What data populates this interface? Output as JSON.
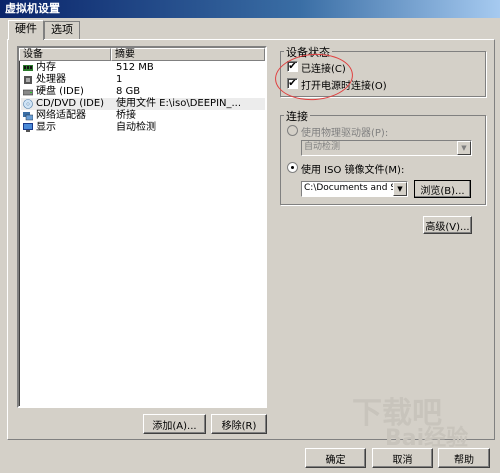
{
  "window": {
    "title": "虚拟机设置"
  },
  "tabs": [
    {
      "label": "硬件",
      "active": true
    },
    {
      "label": "选项",
      "active": false
    }
  ],
  "hardware": {
    "columns": {
      "device": "设备",
      "summary": "摘要"
    },
    "rows": [
      {
        "device": "内存",
        "summary": "512 MB",
        "icon": "memory-icon"
      },
      {
        "device": "处理器",
        "summary": "1",
        "icon": "processor-icon"
      },
      {
        "device": "硬盘 (IDE)",
        "summary": "8 GB",
        "icon": "harddisk-icon"
      },
      {
        "device": "CD/DVD (IDE)",
        "summary": "使用文件 E:\\iso\\DEEPIN_...",
        "icon": "cdrom-icon",
        "selected": true
      },
      {
        "device": "网络适配器",
        "summary": "桥接",
        "icon": "network-icon"
      },
      {
        "device": "显示",
        "summary": "自动检测",
        "icon": "display-icon"
      }
    ],
    "add_button": "添加(A)...",
    "remove_button": "移除(R)"
  },
  "device_status": {
    "title": "设备状态",
    "connected": {
      "label": "已连接(C)",
      "checked": true
    },
    "connect_at_power_on": {
      "label": "打开电源时连接(O)",
      "checked": true
    }
  },
  "connection": {
    "title": "连接",
    "physical_drive": {
      "label": "使用物理驱动器(P):",
      "selected": false,
      "disabled": true
    },
    "physical_drive_combo": "自动检测",
    "iso_image": {
      "label": "使用 ISO 镜像文件(M):",
      "selected": true
    },
    "iso_path": "C:\\Documents and Se",
    "browse_button": "浏览(B)...",
    "advanced_button": "高级(V)..."
  },
  "footer": {
    "ok_button": "确定",
    "cancel_button": "取消",
    "help_button": "帮助"
  },
  "watermark": {
    "text1": "下载吧",
    "text2": "Bai经验"
  },
  "colors": {
    "titlebar": "#0a246a",
    "dialog_bg": "#d4d0c8",
    "annotation": "#e04040"
  }
}
